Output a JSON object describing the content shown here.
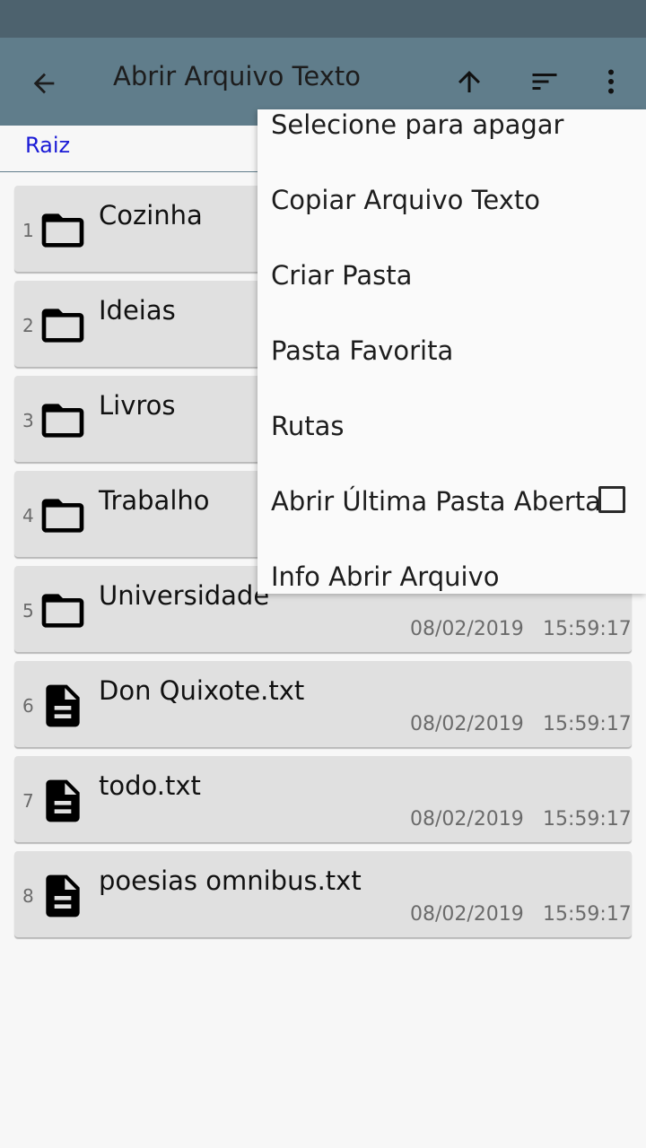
{
  "appbar": {
    "title": "Abrir Arquivo Texto",
    "back_icon": "arrow-left-icon",
    "up_icon": "arrow-up-icon",
    "sort_icon": "sort-icon",
    "more_icon": "more-vert-icon"
  },
  "breadcrumb": {
    "root": "Raiz"
  },
  "files": [
    {
      "index": "1",
      "name": "Cozinha",
      "type": "folder",
      "date": "",
      "time": ""
    },
    {
      "index": "2",
      "name": "Ideias",
      "type": "folder",
      "date": "",
      "time": ""
    },
    {
      "index": "3",
      "name": "Livros",
      "type": "folder",
      "date": "",
      "time": ""
    },
    {
      "index": "4",
      "name": "Trabalho",
      "type": "folder",
      "date": "",
      "time": ""
    },
    {
      "index": "5",
      "name": "Universidade",
      "type": "folder",
      "date": "08/02/2019",
      "time": "15:59:17"
    },
    {
      "index": "6",
      "name": "Don Quixote.txt",
      "type": "file",
      "date": "08/02/2019",
      "time": "15:59:17"
    },
    {
      "index": "7",
      "name": "todo.txt",
      "type": "file",
      "date": "08/02/2019",
      "time": "15:59:17"
    },
    {
      "index": "8",
      "name": "poesias omnibus.txt",
      "type": "file",
      "date": "08/02/2019",
      "time": "15:59:17"
    }
  ],
  "menu": {
    "items": [
      "Selecione para apagar",
      "Copiar Arquivo Texto",
      "Criar Pasta",
      "Pasta Favorita",
      "Rutas",
      "Abrir Última Pasta Aberta",
      "Info Abrir Arquivo"
    ],
    "last_folder_checked": false
  },
  "colors": {
    "statusbar": "#4d626e",
    "appbar": "#607d8b",
    "link": "#1a1ad6",
    "row_bg": "#e0e0e0"
  }
}
